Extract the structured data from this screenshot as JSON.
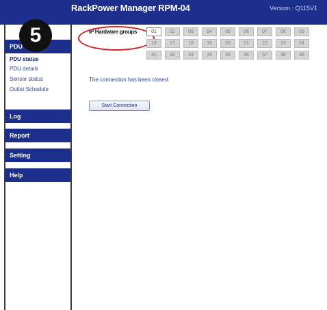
{
  "header": {
    "title": "RackPower Manager  RPM-04",
    "version": "Version : Q115V1"
  },
  "badge": {
    "number": "5"
  },
  "sidebar": {
    "pdu_section": "PDU",
    "items": [
      {
        "label": "PDU status"
      },
      {
        "label": "PDU details"
      },
      {
        "label": "Sensor status"
      },
      {
        "label": "Outlet Schedule"
      }
    ],
    "sections": [
      {
        "label": "Log"
      },
      {
        "label": "Report"
      },
      {
        "label": "Setting"
      },
      {
        "label": "Help"
      }
    ]
  },
  "main": {
    "hardware_label": "IP Hardware groups",
    "hardware_groups": [
      [
        "01",
        "02",
        "03",
        "04",
        "05",
        "06",
        "07",
        "08",
        "09"
      ],
      [
        "16",
        "17",
        "18",
        "19",
        "20",
        "21",
        "22",
        "23",
        "24"
      ],
      [
        "31",
        "32",
        "33",
        "34",
        "35",
        "36",
        "37",
        "38",
        "39"
      ]
    ],
    "selected_group": "01",
    "message": "The connection has been closed.",
    "start_button": "Start Connection"
  },
  "colors": {
    "navy": "#1c2f8c",
    "annotation_red": "#cc2222"
  }
}
